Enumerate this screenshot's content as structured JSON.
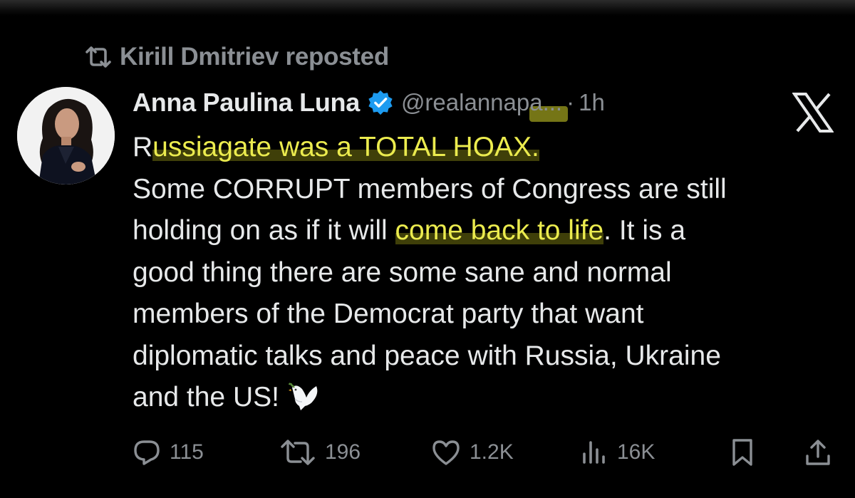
{
  "repost": {
    "icon": "repost-icon",
    "text": "Kirill Dmitriev reposted"
  },
  "author": {
    "name": "Anna Paulina Luna",
    "verified_icon": "verified-badge-icon",
    "handle": "@realannapa...",
    "separator": "·",
    "time": "1h"
  },
  "platform_logo": "X",
  "tweet": {
    "lines": [
      [
        "R",
        "ussiagate was a TOTAL HOAX.",
        ""
      ],
      [
        "Some CORRUPT members of Congress are still",
        "",
        ""
      ],
      [
        "holding on as if it will ",
        "come back to life",
        ". It is a"
      ],
      [
        "good thing there are some sane and normal",
        "",
        ""
      ],
      [
        "members of the Democrat party that want",
        "",
        ""
      ],
      [
        "diplomatic talks and peace with Russia, Ukraine",
        "",
        ""
      ],
      [
        "and the US!",
        "",
        ""
      ]
    ],
    "emoji": "dove-with-olive-branch"
  },
  "actions": {
    "replies": {
      "icon": "reply-icon",
      "count": "115"
    },
    "reposts": {
      "icon": "repost-icon",
      "count": "196"
    },
    "likes": {
      "icon": "heart-icon",
      "count": "1.2K"
    },
    "views": {
      "icon": "views-icon",
      "count": "16K"
    },
    "bookmark": {
      "icon": "bookmark-icon"
    },
    "share": {
      "icon": "share-icon"
    }
  },
  "colors": {
    "background": "#000000",
    "text": "#e7e9ea",
    "muted": "#8b8f94",
    "verified": "#1d9bf0",
    "highlight": "#ebeb4e"
  }
}
